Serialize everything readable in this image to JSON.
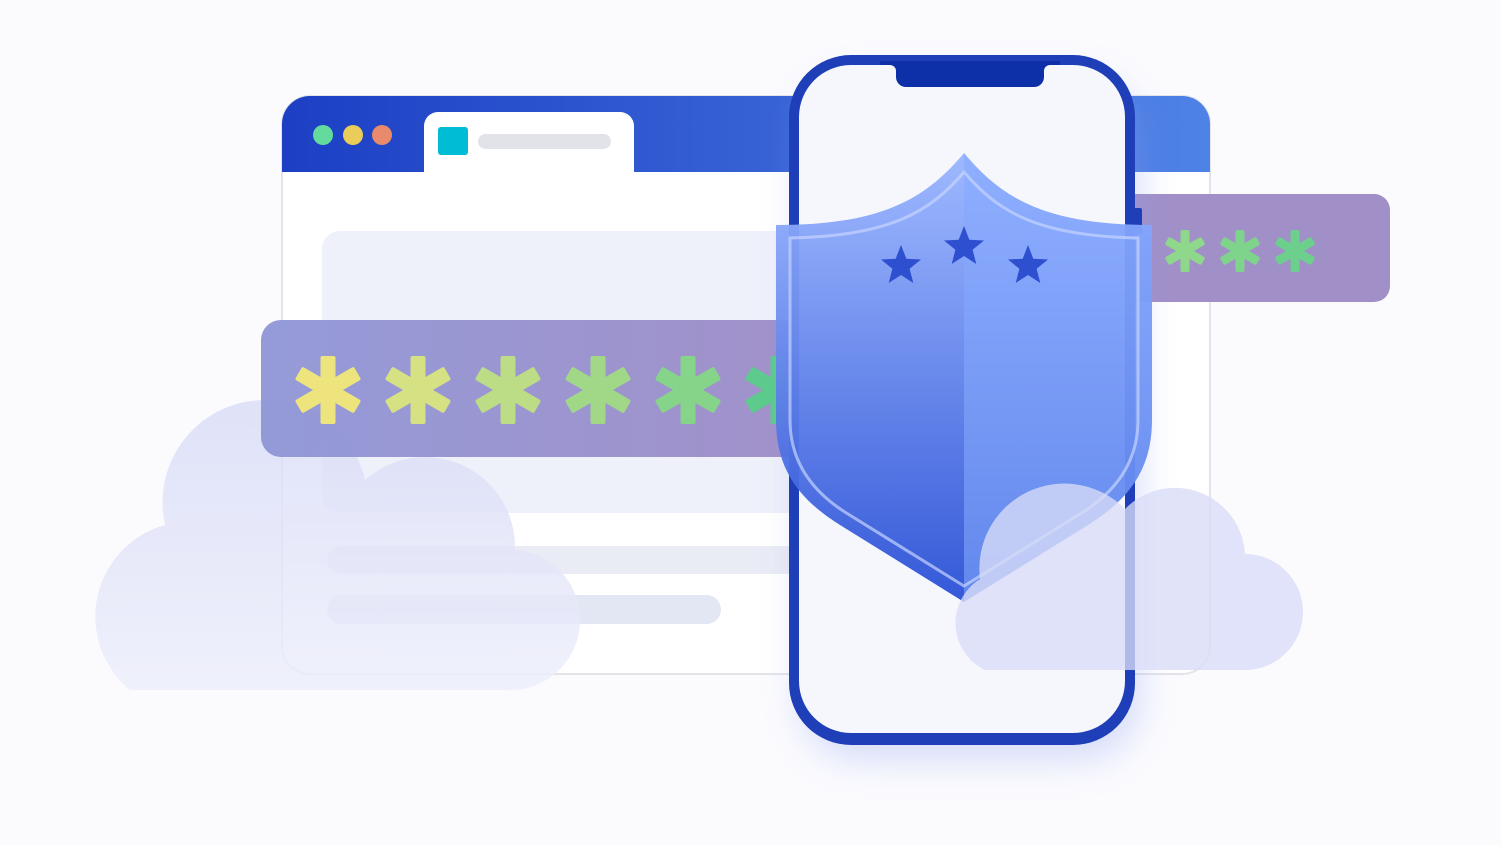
{
  "illustration": {
    "subject": "password-security",
    "colors": {
      "background": "#fbfbfe",
      "browser_header": "#1f45c8",
      "browser_header_end": "#4f82e6",
      "tab_icon": "#00bcd4",
      "dot_green": "#63db9c",
      "dot_yellow": "#e9cc5a",
      "dot_red": "#ea8a6d",
      "password_bar": "#9b8bc8",
      "asterisk_start": "#f0e57e",
      "asterisk_end": "#4fc98a",
      "phone_frame": "#1f3fb8",
      "shield_top": "#93b0ff",
      "shield_bottom": "#2d55d8",
      "star": "#2d4fd0",
      "cloud": "#dfe2f8"
    },
    "icons": {
      "shield": "shield-icon",
      "star": "star-icon",
      "cloud": "cloud-icon",
      "asterisk": "asterisk-icon"
    },
    "large_password_mask": [
      "*",
      "*",
      "*",
      "*",
      "*",
      "*"
    ],
    "small_password_mask": [
      "*",
      "*",
      "*"
    ]
  }
}
